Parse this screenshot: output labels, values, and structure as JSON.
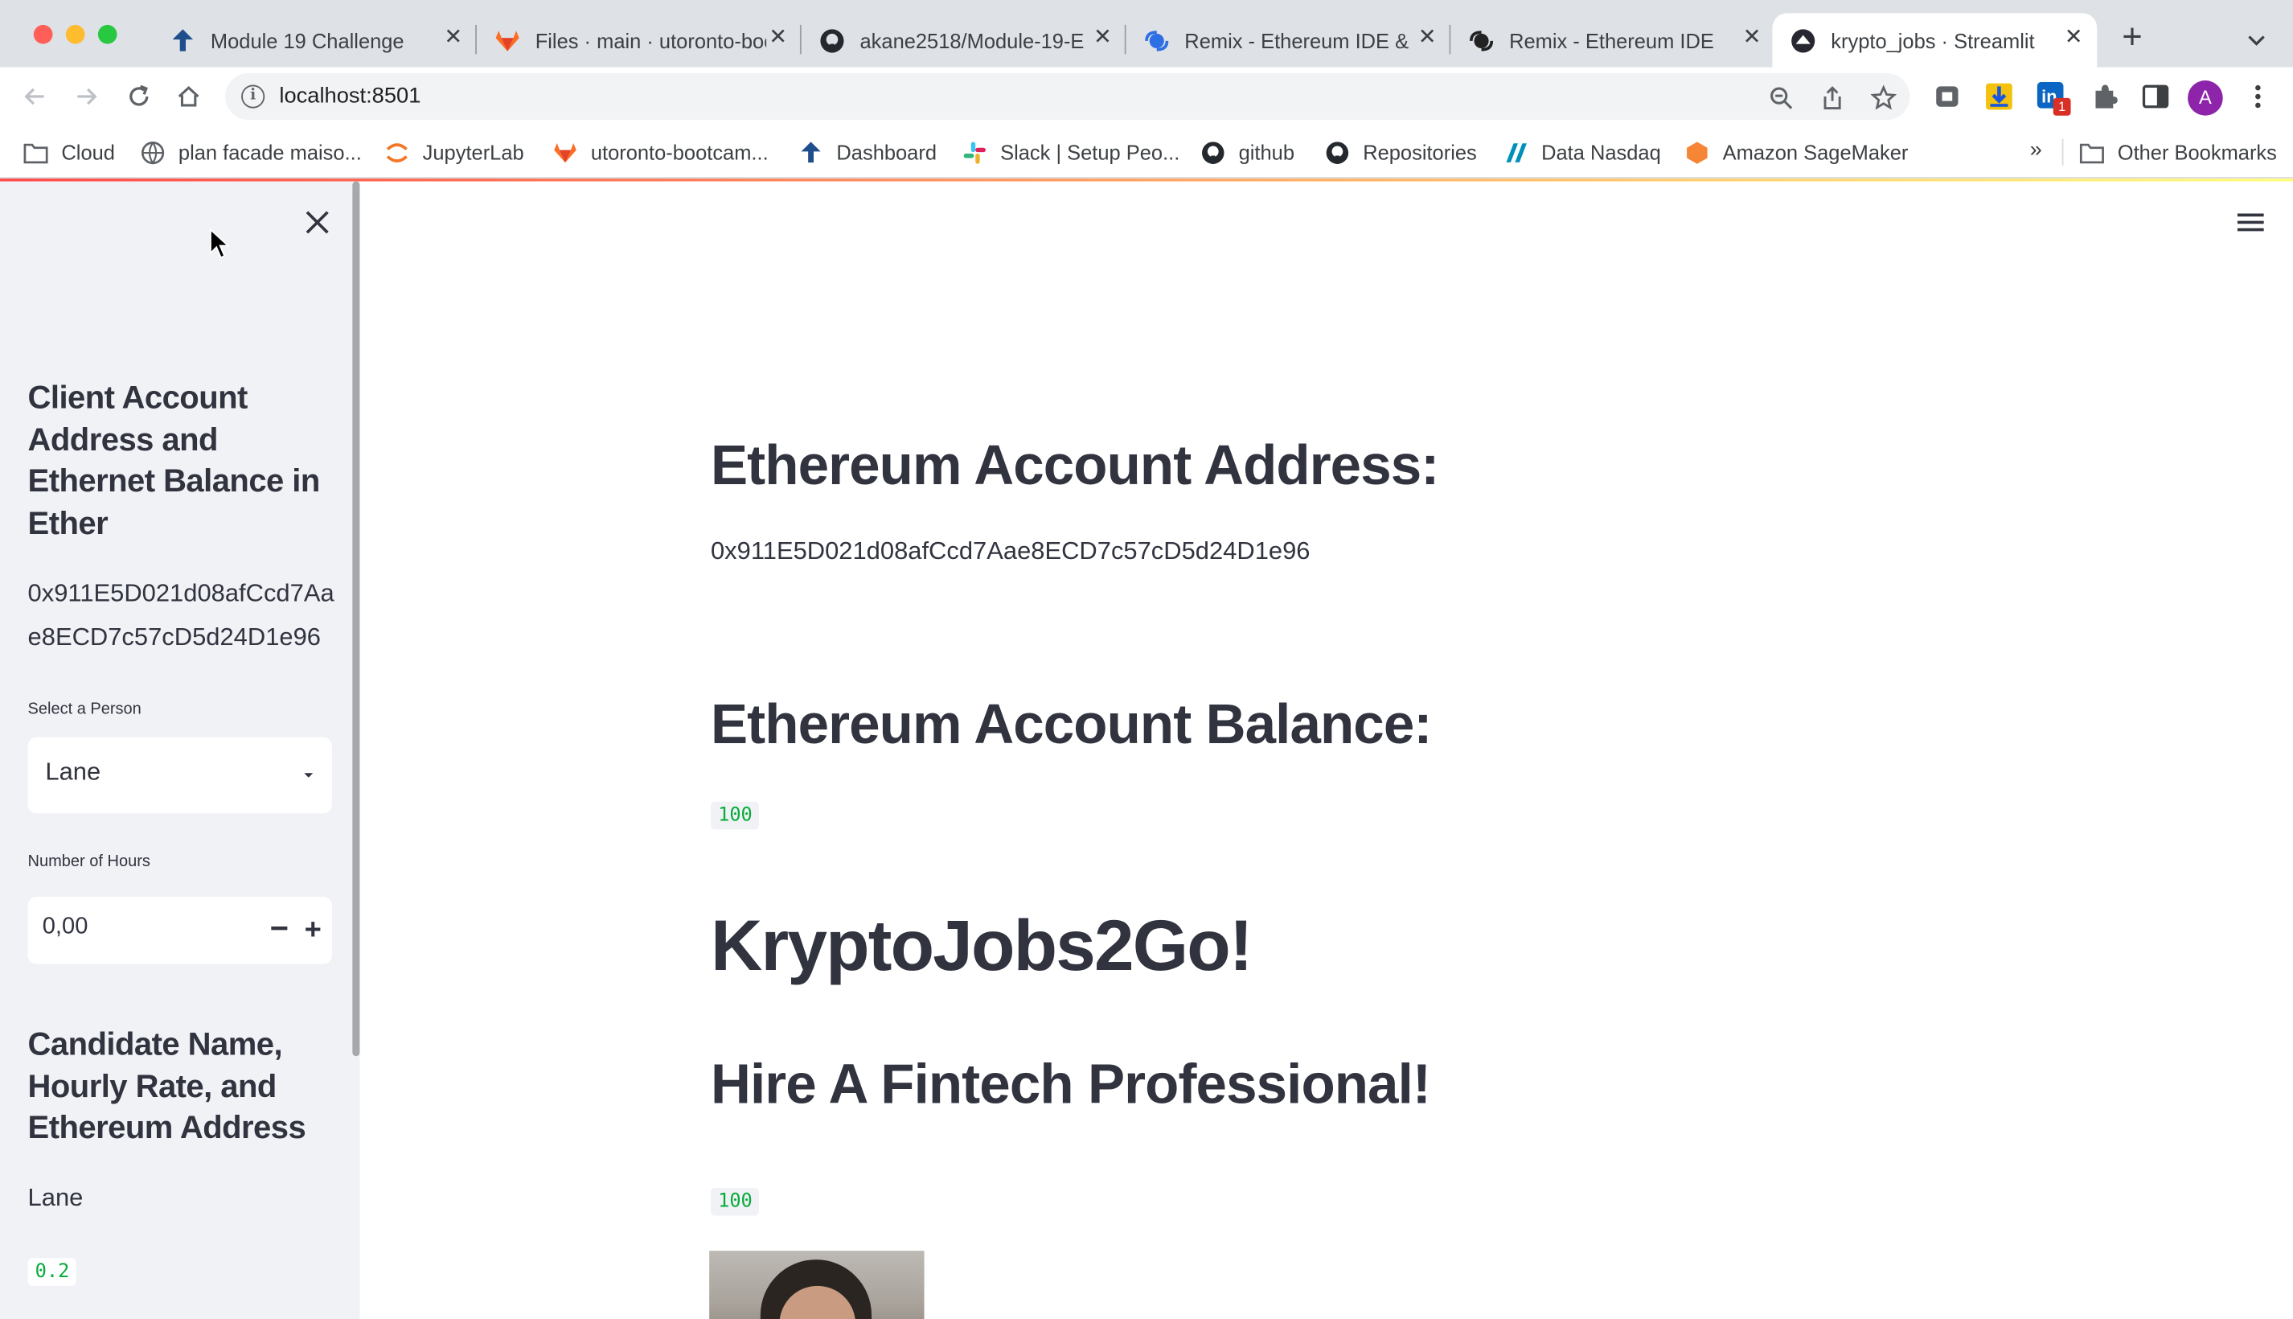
{
  "browser": {
    "tabs": [
      {
        "title": "Module 19 Challenge",
        "icon": "bootcamp-tree-icon"
      },
      {
        "title": "Files · main · utoronto-bootcamp",
        "icon": "gitlab-icon"
      },
      {
        "title": "akane2518/Module-19-E",
        "icon": "github-icon"
      },
      {
        "title": "Remix - Ethereum IDE &",
        "icon": "remix-icon"
      },
      {
        "title": "Remix - Ethereum IDE",
        "icon": "remix-dark-icon"
      },
      {
        "title": "krypto_jobs · Streamlit",
        "icon": "streamlit-icon",
        "active": true
      }
    ],
    "url": "localhost:8501",
    "extension_badge": "1",
    "profile_initial": "A",
    "bookmarks": [
      {
        "label": "Cloud",
        "icon": "folder-icon"
      },
      {
        "label": "plan facade maiso...",
        "icon": "globe-icon"
      },
      {
        "label": "JupyterLab",
        "icon": "jupyter-icon"
      },
      {
        "label": "utoronto-bootcam...",
        "icon": "gitlab-icon"
      },
      {
        "label": "Dashboard",
        "icon": "bootcamp-tree-icon"
      },
      {
        "label": "Slack | Setup Peo...",
        "icon": "slack-icon"
      },
      {
        "label": "github",
        "icon": "github-icon"
      },
      {
        "label": "Repositories",
        "icon": "github-icon"
      },
      {
        "label": "Data Nasdaq",
        "icon": "nasdaq-icon"
      },
      {
        "label": "Amazon SageMaker",
        "icon": "sagemaker-icon"
      }
    ],
    "bookmarks_overflow": "»",
    "other_bookmarks": "Other Bookmarks"
  },
  "sidebar": {
    "heading1": "Client Account Address and Ethernet Balance in Ether",
    "address": "0x911E5D021d08afCcd7Aae8ECD7c57cD5d24D1e96",
    "select_label": "Select a Person",
    "select_value": "Lane",
    "hours_label": "Number of Hours",
    "hours_value": "0,00",
    "heading2": "Candidate Name, Hourly Rate, and Ethereum Address",
    "candidate_name": "Lane",
    "hourly_rate": "0.2"
  },
  "main": {
    "address_heading": "Ethereum Account Address:",
    "address_value": "0x911E5D021d08afCcd7Aae8ECD7c57cD5d24D1e96",
    "balance_heading": "Ethereum Account Balance:",
    "balance_value": "100",
    "app_title": "KryptoJobs2Go!",
    "subtitle": "Hire A Fintech Professional!",
    "second_value": "100"
  },
  "colors": {
    "streamlit_red": "#ff4b4b",
    "code_green": "#09ab3b",
    "sidebar_bg": "#f0f2f6",
    "text": "#31333f"
  }
}
